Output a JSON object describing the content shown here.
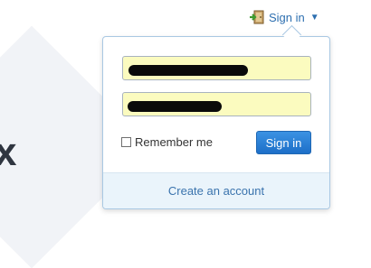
{
  "header": {
    "signin_label": "Sign in",
    "signin_icon": "door-arrow-icon",
    "caret_icon": "caret-down-icon"
  },
  "background": {
    "letter": "x"
  },
  "login_form": {
    "username_value": "",
    "password_value": "",
    "remember_label": "Remember me",
    "remember_checked": false,
    "submit_label": "Sign in"
  },
  "footer": {
    "create_account_label": "Create an account"
  },
  "colors": {
    "accent": "#2d6fb0",
    "button": "#2a80d6",
    "input_fill": "#fbfbbf",
    "footer_bg": "#eaf4fb",
    "border": "#a9c8e3"
  }
}
